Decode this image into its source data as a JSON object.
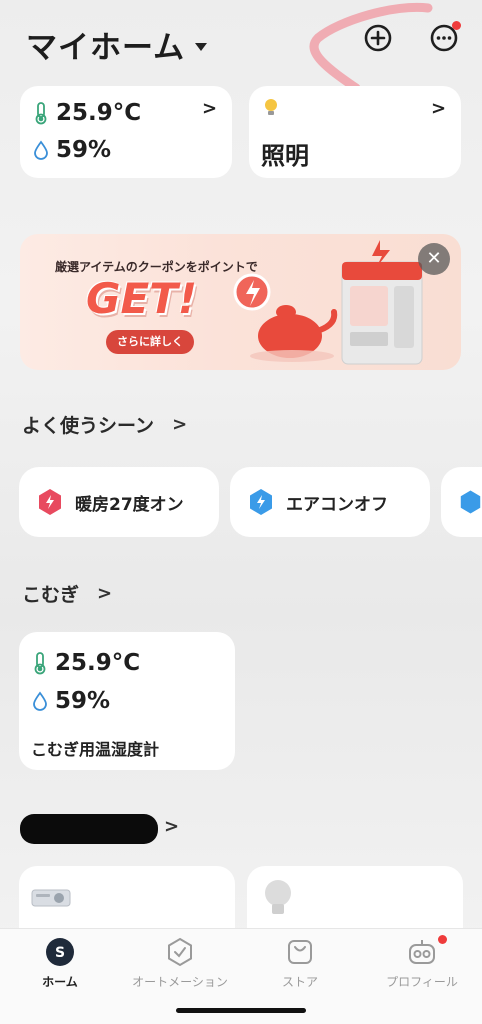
{
  "header": {
    "home_title": "マイホーム",
    "icons": [
      "caret-down-icon",
      "add-circle-icon",
      "more-circle-icon"
    ]
  },
  "climate_card": {
    "temperature": "25.9°C",
    "humidity": "59%"
  },
  "light_card": {
    "label": "照明"
  },
  "banner": {
    "text": "厳選アイテムのクーポンをポイントで",
    "headline": "GET!",
    "button_label": "さらに詳しく",
    "close_glyph": "✕"
  },
  "scenes_section": {
    "title": "よく使うシーン",
    "items": [
      {
        "label": "暖房27度オン",
        "color": "#e84a5f"
      },
      {
        "label": "エアコンオフ",
        "color": "#3a9be8"
      }
    ]
  },
  "room_section": {
    "title": "こむぎ",
    "device": {
      "temperature": "25.9°C",
      "humidity": "59%",
      "name": "こむぎ用温湿度計"
    }
  },
  "tabbar": {
    "tabs": [
      {
        "label": "ホーム",
        "active": true
      },
      {
        "label": "オートメーション",
        "active": false
      },
      {
        "label": "ストア",
        "active": false
      },
      {
        "label": "プロフィール",
        "active": false
      }
    ]
  },
  "colors": {
    "accent_red": "#ef3b3b",
    "thermo_green": "#3aa57a",
    "drop_blue": "#3a8fd8"
  }
}
